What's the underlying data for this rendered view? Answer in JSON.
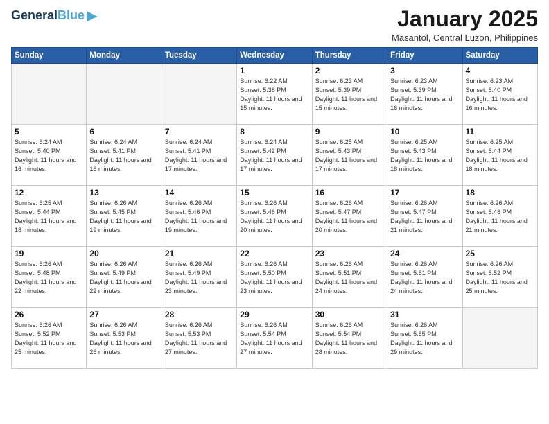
{
  "header": {
    "logo_line1": "General",
    "logo_line2": "Blue",
    "month_title": "January 2025",
    "location": "Masantol, Central Luzon, Philippines"
  },
  "weekdays": [
    "Sunday",
    "Monday",
    "Tuesday",
    "Wednesday",
    "Thursday",
    "Friday",
    "Saturday"
  ],
  "weeks": [
    [
      {
        "day": "",
        "sunrise": "",
        "sunset": "",
        "daylight": "",
        "empty": true
      },
      {
        "day": "",
        "sunrise": "",
        "sunset": "",
        "daylight": "",
        "empty": true
      },
      {
        "day": "",
        "sunrise": "",
        "sunset": "",
        "daylight": "",
        "empty": true
      },
      {
        "day": "1",
        "sunrise": "Sunrise: 6:22 AM",
        "sunset": "Sunset: 5:38 PM",
        "daylight": "Daylight: 11 hours and 15 minutes."
      },
      {
        "day": "2",
        "sunrise": "Sunrise: 6:23 AM",
        "sunset": "Sunset: 5:39 PM",
        "daylight": "Daylight: 11 hours and 15 minutes."
      },
      {
        "day": "3",
        "sunrise": "Sunrise: 6:23 AM",
        "sunset": "Sunset: 5:39 PM",
        "daylight": "Daylight: 11 hours and 16 minutes."
      },
      {
        "day": "4",
        "sunrise": "Sunrise: 6:23 AM",
        "sunset": "Sunset: 5:40 PM",
        "daylight": "Daylight: 11 hours and 16 minutes."
      }
    ],
    [
      {
        "day": "5",
        "sunrise": "Sunrise: 6:24 AM",
        "sunset": "Sunset: 5:40 PM",
        "daylight": "Daylight: 11 hours and 16 minutes."
      },
      {
        "day": "6",
        "sunrise": "Sunrise: 6:24 AM",
        "sunset": "Sunset: 5:41 PM",
        "daylight": "Daylight: 11 hours and 16 minutes."
      },
      {
        "day": "7",
        "sunrise": "Sunrise: 6:24 AM",
        "sunset": "Sunset: 5:41 PM",
        "daylight": "Daylight: 11 hours and 17 minutes."
      },
      {
        "day": "8",
        "sunrise": "Sunrise: 6:24 AM",
        "sunset": "Sunset: 5:42 PM",
        "daylight": "Daylight: 11 hours and 17 minutes."
      },
      {
        "day": "9",
        "sunrise": "Sunrise: 6:25 AM",
        "sunset": "Sunset: 5:43 PM",
        "daylight": "Daylight: 11 hours and 17 minutes."
      },
      {
        "day": "10",
        "sunrise": "Sunrise: 6:25 AM",
        "sunset": "Sunset: 5:43 PM",
        "daylight": "Daylight: 11 hours and 18 minutes."
      },
      {
        "day": "11",
        "sunrise": "Sunrise: 6:25 AM",
        "sunset": "Sunset: 5:44 PM",
        "daylight": "Daylight: 11 hours and 18 minutes."
      }
    ],
    [
      {
        "day": "12",
        "sunrise": "Sunrise: 6:25 AM",
        "sunset": "Sunset: 5:44 PM",
        "daylight": "Daylight: 11 hours and 18 minutes."
      },
      {
        "day": "13",
        "sunrise": "Sunrise: 6:26 AM",
        "sunset": "Sunset: 5:45 PM",
        "daylight": "Daylight: 11 hours and 19 minutes."
      },
      {
        "day": "14",
        "sunrise": "Sunrise: 6:26 AM",
        "sunset": "Sunset: 5:46 PM",
        "daylight": "Daylight: 11 hours and 19 minutes."
      },
      {
        "day": "15",
        "sunrise": "Sunrise: 6:26 AM",
        "sunset": "Sunset: 5:46 PM",
        "daylight": "Daylight: 11 hours and 20 minutes."
      },
      {
        "day": "16",
        "sunrise": "Sunrise: 6:26 AM",
        "sunset": "Sunset: 5:47 PM",
        "daylight": "Daylight: 11 hours and 20 minutes."
      },
      {
        "day": "17",
        "sunrise": "Sunrise: 6:26 AM",
        "sunset": "Sunset: 5:47 PM",
        "daylight": "Daylight: 11 hours and 21 minutes."
      },
      {
        "day": "18",
        "sunrise": "Sunrise: 6:26 AM",
        "sunset": "Sunset: 5:48 PM",
        "daylight": "Daylight: 11 hours and 21 minutes."
      }
    ],
    [
      {
        "day": "19",
        "sunrise": "Sunrise: 6:26 AM",
        "sunset": "Sunset: 5:48 PM",
        "daylight": "Daylight: 11 hours and 22 minutes."
      },
      {
        "day": "20",
        "sunrise": "Sunrise: 6:26 AM",
        "sunset": "Sunset: 5:49 PM",
        "daylight": "Daylight: 11 hours and 22 minutes."
      },
      {
        "day": "21",
        "sunrise": "Sunrise: 6:26 AM",
        "sunset": "Sunset: 5:49 PM",
        "daylight": "Daylight: 11 hours and 23 minutes."
      },
      {
        "day": "22",
        "sunrise": "Sunrise: 6:26 AM",
        "sunset": "Sunset: 5:50 PM",
        "daylight": "Daylight: 11 hours and 23 minutes."
      },
      {
        "day": "23",
        "sunrise": "Sunrise: 6:26 AM",
        "sunset": "Sunset: 5:51 PM",
        "daylight": "Daylight: 11 hours and 24 minutes."
      },
      {
        "day": "24",
        "sunrise": "Sunrise: 6:26 AM",
        "sunset": "Sunset: 5:51 PM",
        "daylight": "Daylight: 11 hours and 24 minutes."
      },
      {
        "day": "25",
        "sunrise": "Sunrise: 6:26 AM",
        "sunset": "Sunset: 5:52 PM",
        "daylight": "Daylight: 11 hours and 25 minutes."
      }
    ],
    [
      {
        "day": "26",
        "sunrise": "Sunrise: 6:26 AM",
        "sunset": "Sunset: 5:52 PM",
        "daylight": "Daylight: 11 hours and 25 minutes."
      },
      {
        "day": "27",
        "sunrise": "Sunrise: 6:26 AM",
        "sunset": "Sunset: 5:53 PM",
        "daylight": "Daylight: 11 hours and 26 minutes."
      },
      {
        "day": "28",
        "sunrise": "Sunrise: 6:26 AM",
        "sunset": "Sunset: 5:53 PM",
        "daylight": "Daylight: 11 hours and 27 minutes."
      },
      {
        "day": "29",
        "sunrise": "Sunrise: 6:26 AM",
        "sunset": "Sunset: 5:54 PM",
        "daylight": "Daylight: 11 hours and 27 minutes."
      },
      {
        "day": "30",
        "sunrise": "Sunrise: 6:26 AM",
        "sunset": "Sunset: 5:54 PM",
        "daylight": "Daylight: 11 hours and 28 minutes."
      },
      {
        "day": "31",
        "sunrise": "Sunrise: 6:26 AM",
        "sunset": "Sunset: 5:55 PM",
        "daylight": "Daylight: 11 hours and 29 minutes."
      },
      {
        "day": "",
        "sunrise": "",
        "sunset": "",
        "daylight": "",
        "empty": true
      }
    ]
  ]
}
